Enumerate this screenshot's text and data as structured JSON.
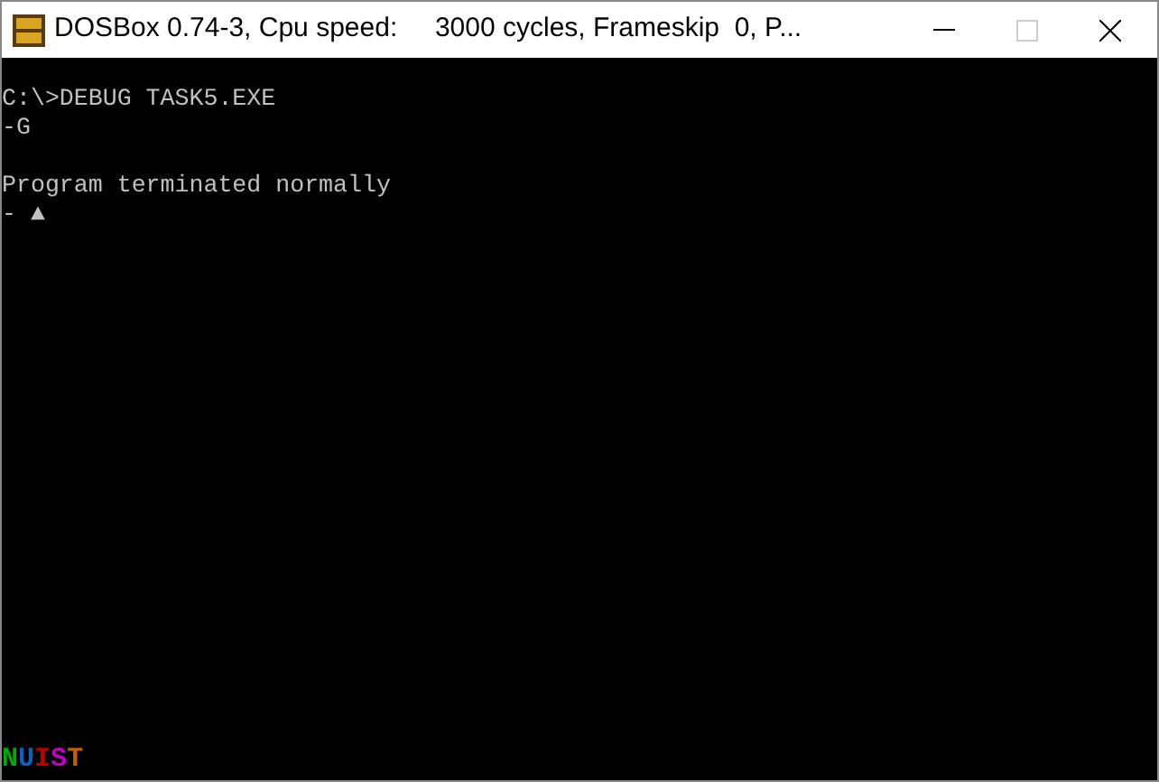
{
  "window": {
    "title": "DOSBox 0.74-3, Cpu speed:     3000 cycles, Frameskip  0, P..."
  },
  "console": {
    "blocks": [
      {
        "lines": [
          "C:\\>DEBUG TASK5.EXE",
          "-G"
        ]
      },
      {
        "lines": [
          "Program terminated normally",
          "- ▲"
        ]
      }
    ]
  },
  "footer_mark": [
    {
      "letter": "N",
      "color": "#00a800"
    },
    {
      "letter": "U",
      "color": "#1060c0"
    },
    {
      "letter": "I",
      "color": "#c00000"
    },
    {
      "letter": "S",
      "color": "#c000c0"
    },
    {
      "letter": "T",
      "color": "#c06000"
    }
  ]
}
